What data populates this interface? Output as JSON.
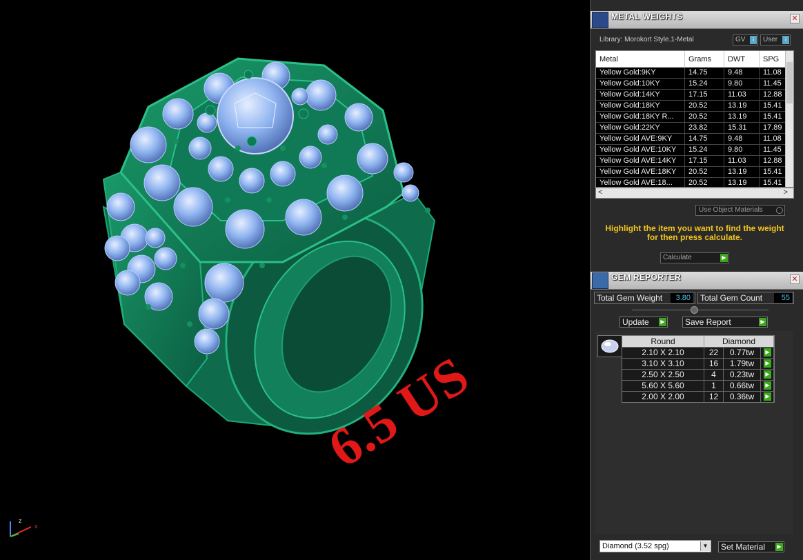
{
  "viewport": {
    "ring_size_label": "6.5 US",
    "axis_z": "z",
    "axis_x": "x"
  },
  "metal_weights": {
    "title": "METAL WEIGHTS",
    "library": "Library: Morokort Style.1-Metal",
    "gv_label": "GV",
    "user_label": "User",
    "columns": [
      "Metal",
      "Grams",
      "DWT",
      "SPG"
    ],
    "rows": [
      [
        "Yellow Gold:9KY",
        "14.75",
        "9.48",
        "11.08"
      ],
      [
        "Yellow Gold:10KY",
        "15.24",
        "9.80",
        "11.45"
      ],
      [
        "Yellow Gold:14KY",
        "17.15",
        "11.03",
        "12.88"
      ],
      [
        "Yellow Gold:18KY",
        "20.52",
        "13.19",
        "15.41"
      ],
      [
        "Yellow Gold:18KY R...",
        "20.52",
        "13.19",
        "15.41"
      ],
      [
        "Yellow Gold:22KY",
        "23.82",
        "15.31",
        "17.89"
      ],
      [
        "Yellow Gold AVE:9KY",
        "14.75",
        "9.48",
        "11.08"
      ],
      [
        "Yellow Gold AVE:10KY",
        "15.24",
        "9.80",
        "11.45"
      ],
      [
        "Yellow Gold AVE:14KY",
        "17.15",
        "11.03",
        "12.88"
      ],
      [
        "Yellow Gold AVE:18KY",
        "20.52",
        "13.19",
        "15.41"
      ],
      [
        "Yellow Gold AVE:18...",
        "20.52",
        "13.19",
        "15.41"
      ]
    ],
    "use_object_materials": "Use Object Materials",
    "highlight_message": "Highlight the item you want to find the weight for then press calculate.",
    "calculate_label": "Calculate"
  },
  "gem_reporter": {
    "title": "GEM REPORTER",
    "total_weight_label": "Total Gem Weight",
    "total_weight_value": "3.80",
    "total_count_label": "Total Gem Count",
    "total_count_value": "55",
    "update_label": "Update",
    "save_report_label": "Save Report",
    "shape_header": "Round",
    "stone_header": "Diamond",
    "rows": [
      [
        "2.10 X 2.10",
        "22",
        "0.77tw"
      ],
      [
        "3.10 X 3.10",
        "16",
        "1.79tw"
      ],
      [
        "2.50 X 2.50",
        "4",
        "0.23tw"
      ],
      [
        "5.60 X 5.60",
        "1",
        "0.66tw"
      ],
      [
        "2.00 X 2.00",
        "12",
        "0.36tw"
      ]
    ],
    "material_selected": "Diamond    (3.52 spg)",
    "set_material_label": "Set Material"
  },
  "colors": {
    "ring_metal": "#0f7a55",
    "gems": "#8fb4f0",
    "ring_size": "#e01818",
    "message": "#f3c61e",
    "go_button": "#3ca81e"
  }
}
